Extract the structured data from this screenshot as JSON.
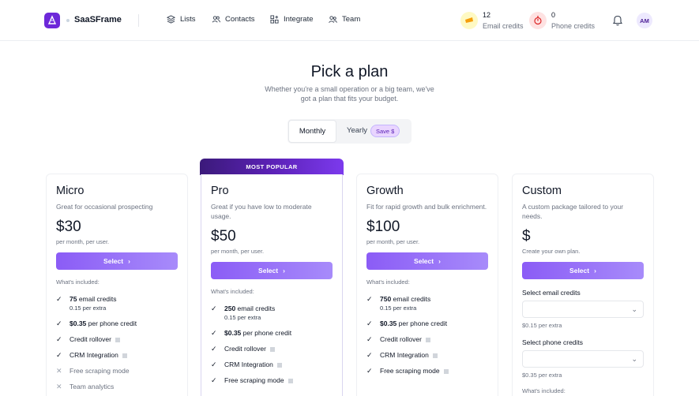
{
  "header": {
    "brand": "SaaSFrame",
    "nav": [
      {
        "label": "Lists",
        "icon": "layers-icon"
      },
      {
        "label": "Contacts",
        "icon": "users-icon"
      },
      {
        "label": "Integrate",
        "icon": "grid-plus-icon"
      },
      {
        "label": "Team",
        "icon": "team-icon"
      }
    ],
    "email_credits": {
      "count": "12",
      "label": "Email credits"
    },
    "phone_credits": {
      "count": "0",
      "label": "Phone credits"
    },
    "avatar": "AM"
  },
  "page": {
    "title": "Pick a plan",
    "subtitle": "Whether you're a small operation or a big team, we've got a plan that fits your budget."
  },
  "billing_toggle": {
    "monthly": "Monthly",
    "yearly": "Yearly",
    "save_badge": "Save $"
  },
  "colors": {
    "accent": "#8b5cf6",
    "banner": "#4c1d95"
  },
  "plans": [
    {
      "name": "Micro",
      "description": "Great for occasional prospecting",
      "price": "$30",
      "per": "per month, per user.",
      "select": "Select",
      "included": "What's included:",
      "features": [
        {
          "bold": "75",
          "text": " email credits",
          "sub": "0.15 per extra"
        },
        {
          "bold": "$0.35",
          "text": " per phone credit"
        },
        {
          "text": "Credit rollover"
        },
        {
          "text": "CRM Integration"
        },
        {
          "text": "Free scraping mode"
        },
        {
          "text": "Team analytics"
        }
      ]
    },
    {
      "banner": "MOST POPULAR",
      "name": "Pro",
      "description": "Great if you have low to moderate usage.",
      "price": "$50",
      "per": "per month, per user.",
      "select": "Select",
      "included": "What's included:",
      "features": [
        {
          "bold": "250",
          "text": " email credits",
          "sub": "0.15 per extra"
        },
        {
          "bold": "$0.35",
          "text": " per phone credit"
        },
        {
          "text": "Credit rollover"
        },
        {
          "text": "CRM Integration"
        },
        {
          "text": "Free scraping mode"
        }
      ]
    },
    {
      "name": "Growth",
      "description": "Fit for rapid growth and bulk enrichment.",
      "price": "$100",
      "per": "per month, per user.",
      "select": "Select",
      "included": "What's included:",
      "features": [
        {
          "bold": "750",
          "text": " email credits",
          "sub": "0.15 per extra"
        },
        {
          "bold": "$0.35",
          "text": " per phone credit"
        },
        {
          "text": "Credit rollover"
        },
        {
          "text": "CRM Integration"
        },
        {
          "text": "Free scraping mode"
        }
      ]
    },
    {
      "name": "Custom",
      "description": "A custom package tailored to your needs.",
      "price": "$",
      "per": "Create your own plan.",
      "select": "Select",
      "email_select_label": "Select email credits",
      "email_price": "$0.15 per extra",
      "phone_select_label": "Select phone credits",
      "phone_price": "$0.35 per extra",
      "included": "What's included:"
    }
  ]
}
